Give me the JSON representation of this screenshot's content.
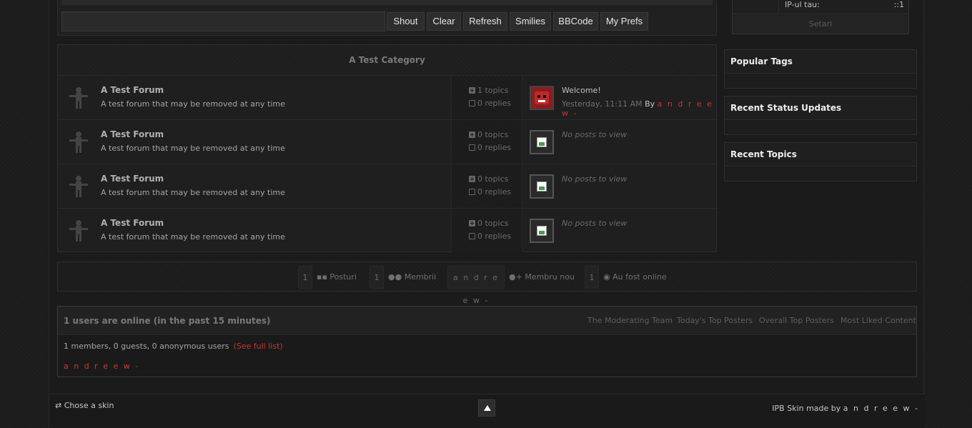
{
  "shoutbox": {
    "input_value": "",
    "buttons": [
      "Shout",
      "Clear",
      "Refresh",
      "Smilies",
      "BBCode",
      "My Prefs"
    ]
  },
  "category": {
    "title": "A Test Category",
    "forums": [
      {
        "title": "A Test Forum",
        "description": "A test forum that may be removed at any time",
        "topics": "1 topics",
        "replies": "0 replies",
        "last_post_title": "Welcome!",
        "last_post_time": "Yesterday, 11:11 AM",
        "by": "By",
        "last_post_author": "a n d r e e w -"
      },
      {
        "title": "A Test Forum",
        "description": "A test forum that may be removed at any time",
        "topics": "0 topics",
        "replies": "0 replies",
        "no_posts": "No posts to view"
      },
      {
        "title": "A Test Forum",
        "description": "A test forum that may be removed at any time",
        "topics": "0 topics",
        "replies": "0 replies",
        "no_posts": "No posts to view"
      },
      {
        "title": "A Test Forum",
        "description": "A test forum that may be removed at any time",
        "topics": "0 topics",
        "replies": "0 replies",
        "no_posts": "No posts to view"
      }
    ]
  },
  "stats_bar": {
    "posts_count": "1",
    "posts_label": "Posturi",
    "members_count": "1",
    "members_label": "Membrii",
    "newest_member": "a n d r e e w -",
    "newest_label": "Membru nou",
    "online_count": "1",
    "online_label": "Au fost online"
  },
  "online": {
    "title": "1 users are online (in the past 15 minutes)",
    "links": [
      "The Moderating Team",
      "Today's Top Posters",
      "Overall Top Posters",
      "Most Liked Content"
    ],
    "summary": "1 members, 0 guests, 0 anonymous users",
    "full_list": "(See full list)",
    "user": "a n d r e e w -"
  },
  "footer": {
    "skin_label": "Chose a skin",
    "credit_prefix": "IPB Skin made by",
    "credit_name": "a n d r e e w -"
  },
  "sidebar": {
    "ip_label": "IP-ul tau:",
    "ip_value": "::1",
    "settings": "Setari",
    "boxes": [
      "Popular Tags",
      "Recent Status Updates",
      "Recent Topics"
    ]
  }
}
